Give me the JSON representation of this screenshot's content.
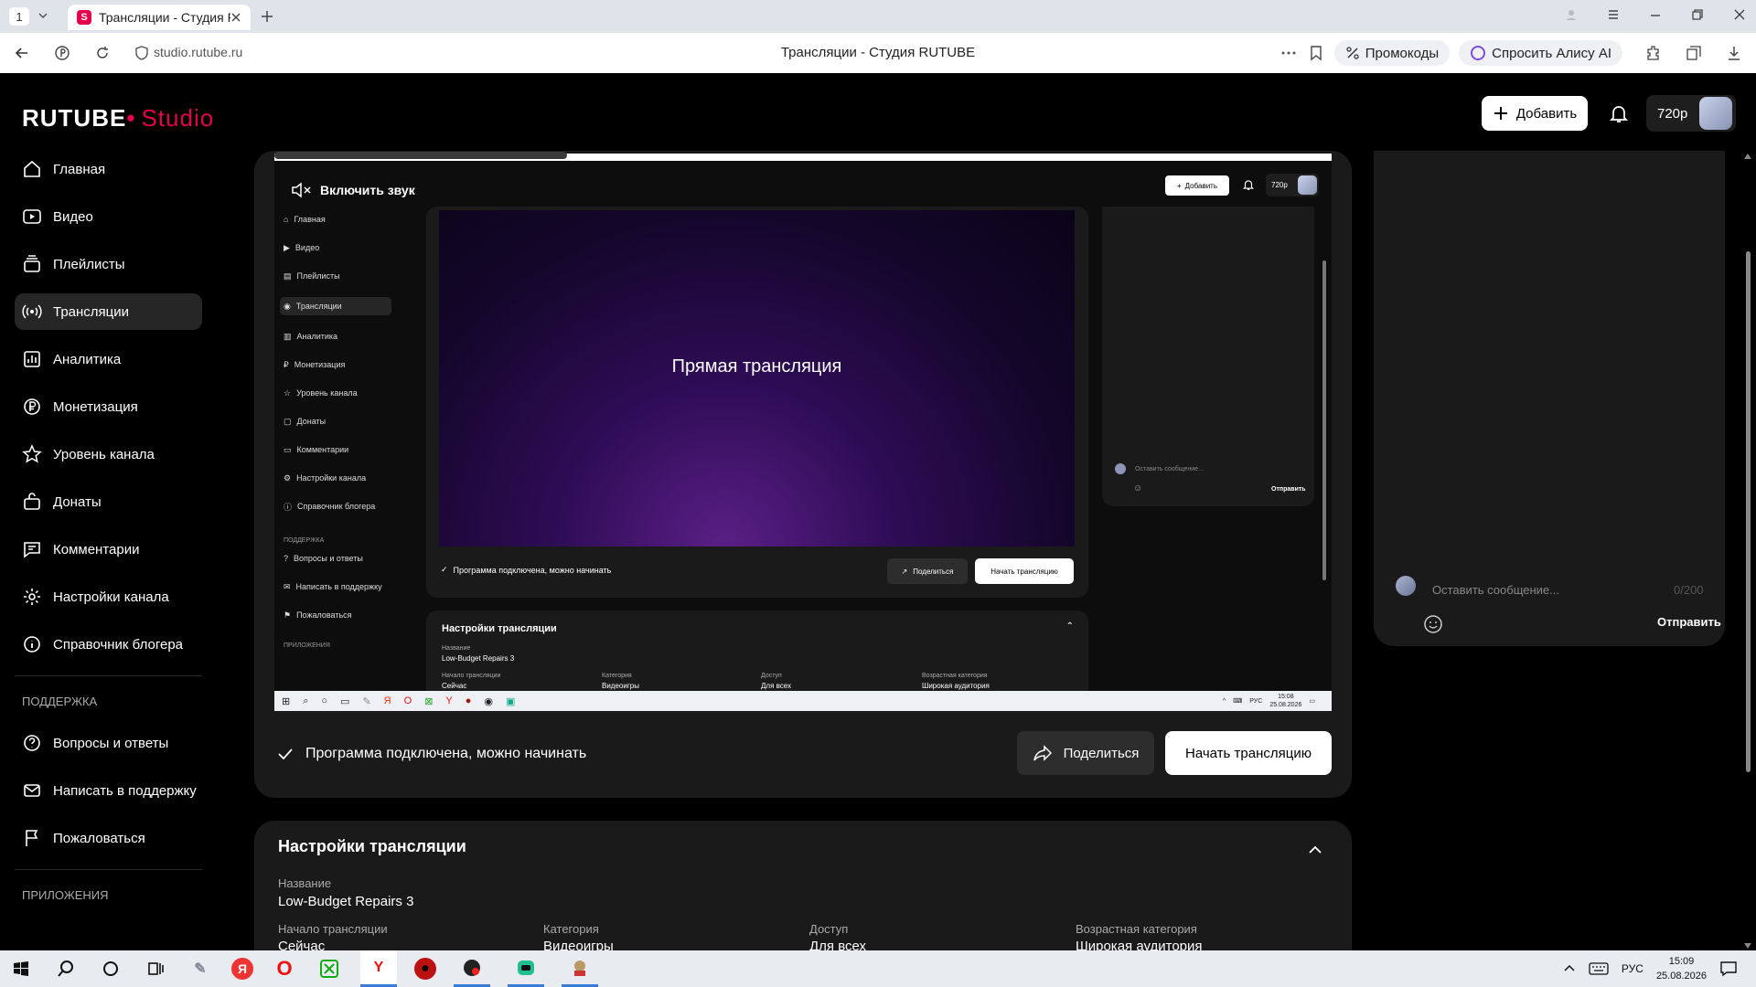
{
  "browser": {
    "tab_count": "1",
    "tab_title": "Трансляции - Студия R",
    "url": "studio.rutube.ru",
    "page_title": "Трансляции - Студия RUTUBE",
    "promo_label": "Промокоды",
    "alice_label": "Спросить Алису AI"
  },
  "app": {
    "logo_main": "RUTUBE",
    "logo_studio": "Studio",
    "add_label": "Добавить",
    "quality": "720p"
  },
  "sidebar": {
    "items": [
      {
        "label": "Главная",
        "icon": "home-icon"
      },
      {
        "label": "Видео",
        "icon": "video-icon"
      },
      {
        "label": "Плейлисты",
        "icon": "playlist-icon"
      },
      {
        "label": "Трансляции",
        "icon": "broadcast-icon"
      },
      {
        "label": "Аналитика",
        "icon": "analytics-icon"
      },
      {
        "label": "Монетизация",
        "icon": "ruble-icon"
      },
      {
        "label": "Уровень канала",
        "icon": "star-icon"
      },
      {
        "label": "Донаты",
        "icon": "gift-icon"
      },
      {
        "label": "Комментарии",
        "icon": "comment-icon"
      },
      {
        "label": "Настройки канала",
        "icon": "gear-icon"
      },
      {
        "label": "Справочник блогера",
        "icon": "info-icon"
      }
    ],
    "support_heading": "ПОДДЕРЖКА",
    "support_items": [
      {
        "label": "Вопросы и ответы",
        "icon": "question-icon"
      },
      {
        "label": "Написать в поддержку",
        "icon": "mail-icon"
      },
      {
        "label": "Пожаловаться",
        "icon": "flag-icon"
      }
    ],
    "apps_heading": "ПРИЛОЖЕНИЯ"
  },
  "preview": {
    "unmute_label": "Включить звук",
    "video_title": "Прямая трансляция",
    "add_label": "Добавить",
    "quality": "720p",
    "chat_placeholder": "Оставить сообщение...",
    "chat_send": "Отправить",
    "status": "Программа подключена, можно начинать",
    "share": "Поделиться",
    "start": "Начать трансляцию",
    "settings_title": "Настройки трансляции",
    "name_label": "Название",
    "name_value": "Low-Budget Repairs 3",
    "start_label": "Начало трансляции",
    "start_value": "Сейчас",
    "category_label": "Категория",
    "category_value": "Видеоигры",
    "access_label": "Доступ",
    "access_value": "Для всех",
    "age_label": "Возрастная категория",
    "age_value": "Широкая аудитория",
    "support_heading": "ПОДДЕРЖКА",
    "apps_heading": "ПРИЛОЖЕНИЯ",
    "tray_lang": "РУС",
    "tray_time": "15:08",
    "tray_date": "25.08.2026"
  },
  "main": {
    "status": "Программа подключена, можно начинать",
    "share_label": "Поделиться",
    "start_label": "Начать трансляцию",
    "settings_title": "Настройки трансляции",
    "name_label": "Название",
    "name_value": "Low-Budget Repairs 3",
    "start_time_label": "Начало трансляции",
    "start_time_value": "Сейчас",
    "category_label": "Категория",
    "category_value": "Видеоигры",
    "access_label": "Доступ",
    "access_value": "Для всех",
    "age_label": "Возрастная категория",
    "age_value": "Широкая аудитория"
  },
  "chat": {
    "placeholder": "Оставить сообщение...",
    "counter": "0/200",
    "send_label": "Отправить"
  },
  "taskbar": {
    "lang": "РУС",
    "time": "15:09",
    "date": "25.08.2026"
  },
  "colors": {
    "brand": "#e5004b",
    "accent_purple": "#5a1f86",
    "panel": "#1a1a1a"
  }
}
